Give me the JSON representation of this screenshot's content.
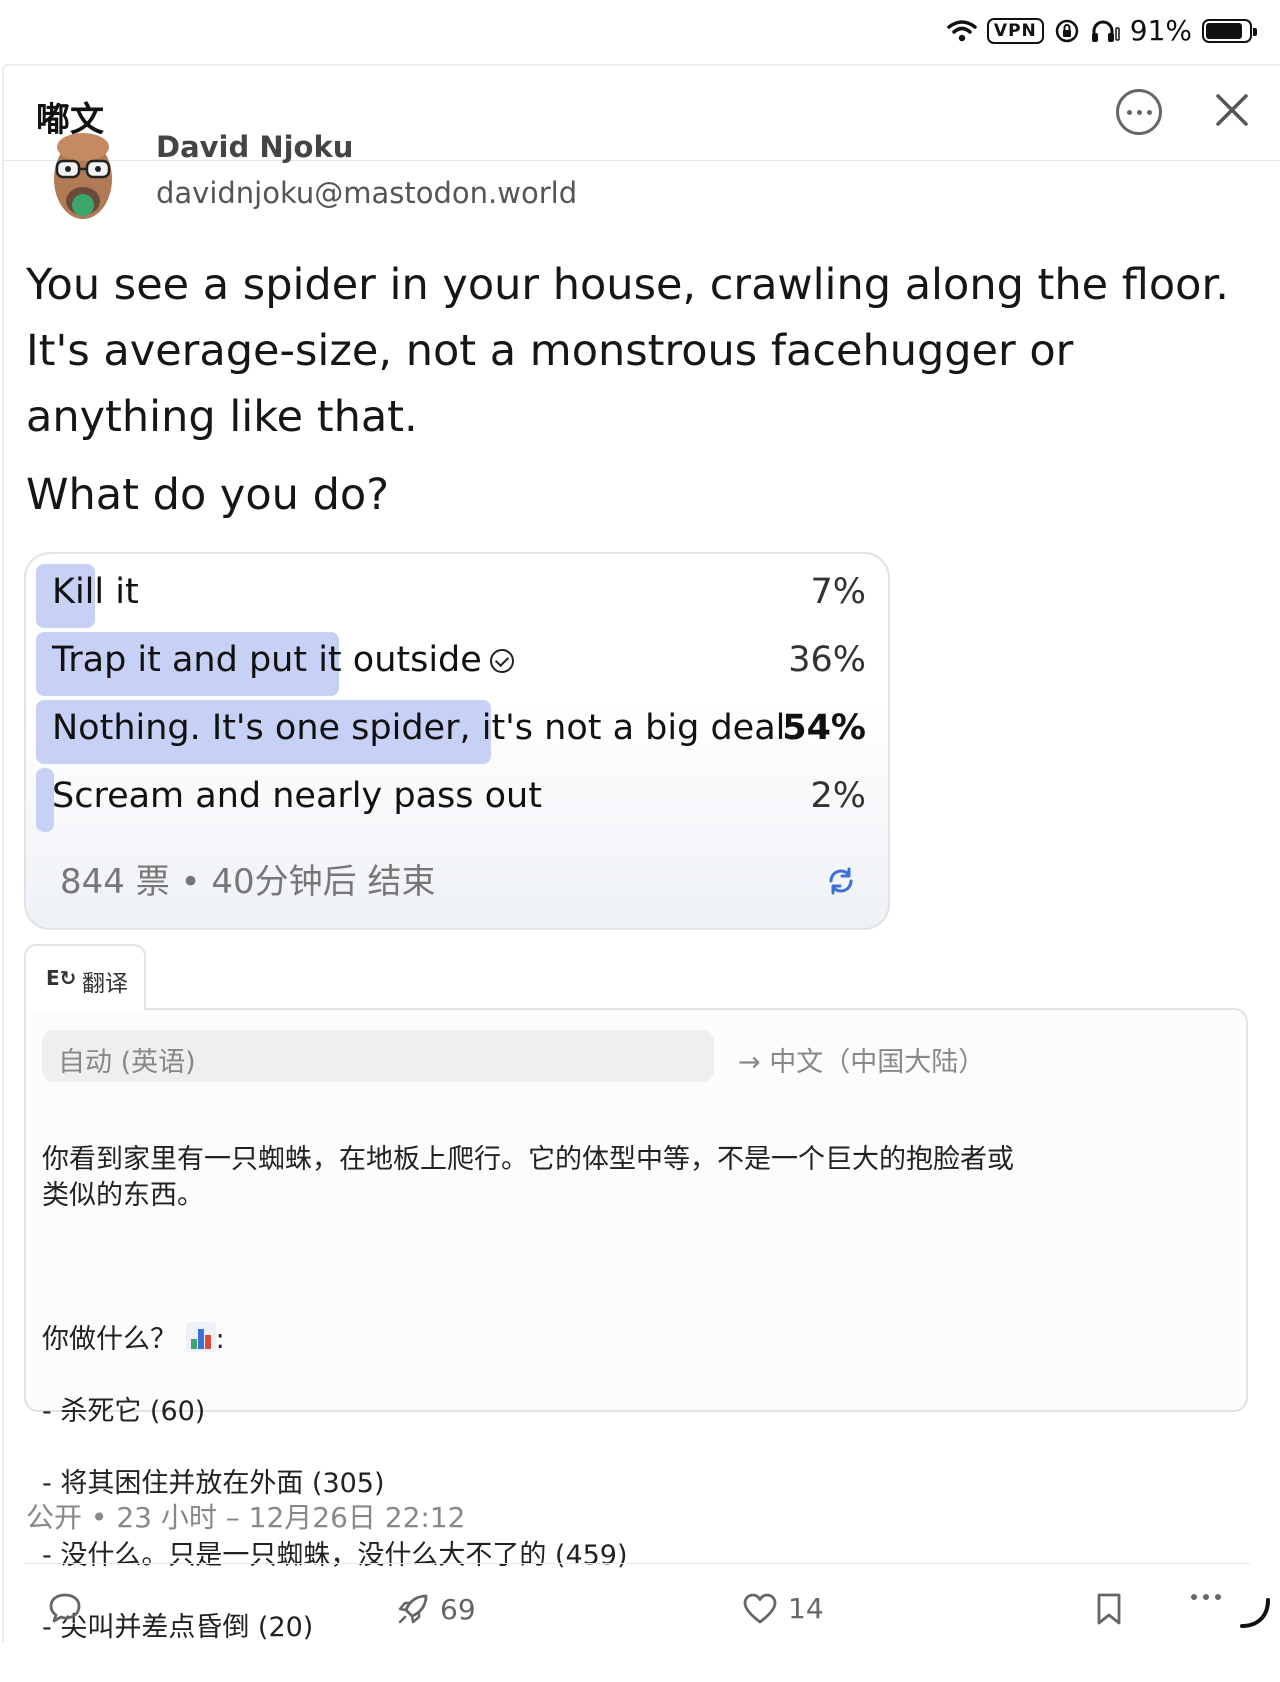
{
  "status_bar": {
    "vpn": "VPN",
    "battery": "91%",
    "battery_level": 0.91
  },
  "header": {
    "title": "嘟文"
  },
  "author": {
    "name": "David Njoku",
    "handle": "davidnjoku@mastodon.world"
  },
  "post": {
    "text": "You see a spider in your house, crawling along the floor. It's average-size, not a monstrous facehugger or anything like that.",
    "question": "What do you do?"
  },
  "poll": {
    "options": [
      {
        "label": "Kill it",
        "percent_label": "7%",
        "percent": 7
      },
      {
        "label": "Trap it and put it outside",
        "percent_label": "36%",
        "percent": 36
      },
      {
        "label": "Nothing. It's one spider, it's not a big deal",
        "percent_label": "54%",
        "percent": 54
      },
      {
        "label": "Scream and nearly pass out",
        "percent_label": "2%",
        "percent": 2
      }
    ],
    "footer": "844 票 • 40分钟后 结束",
    "accent": "#c7d0f5"
  },
  "translation": {
    "tab_label": "翻译",
    "source_lang": "自动 (英语)",
    "target_lang": "→ 中文（中国大陆）",
    "para1": "你看到家里有一只蜘蛛，在地板上爬行。它的体型中等，不是一个巨大的抱脸者或\n类似的东西。",
    "q_text": "你做什么？",
    "q_colon": ":",
    "items": [
      "- 杀死它 (60)",
      "- 将其困住并放在外面 (305)",
      "- 没什么。只是一只蜘蛛，没什么大不了的 (459)",
      "- 尖叫并差点昏倒 (20)"
    ]
  },
  "meta": {
    "text": "公开 • 23 小时 – 12月26日 22:12"
  },
  "actions": {
    "boosts": "69",
    "favourites": "14"
  }
}
